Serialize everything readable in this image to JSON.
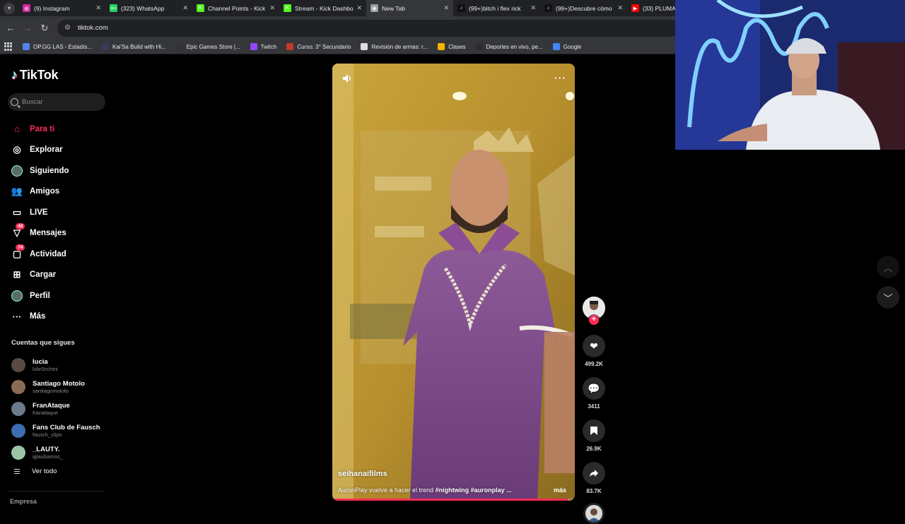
{
  "browser": {
    "tabs": [
      {
        "label": "(9) Instagram",
        "color": "#d6249f",
        "glyph": "◎"
      },
      {
        "label": "(323) WhatsApp",
        "color": "#25d366",
        "glyph": "99+"
      },
      {
        "label": "Channel Points - Kick",
        "color": "#53fc18",
        "glyph": "K"
      },
      {
        "label": "Stream - Kick Dashbo",
        "color": "#53fc18",
        "glyph": "K"
      },
      {
        "label": "New Tab",
        "color": "#9aa0a6",
        "glyph": "◉",
        "active": true
      },
      {
        "label": "(99+)bitch i flex rick",
        "color": "#111111",
        "glyph": "♪"
      },
      {
        "label": "(99+)Descubre cómo",
        "color": "#111111",
        "glyph": "♪"
      },
      {
        "label": "(33) PLUMA",
        "color": "#ff0000",
        "glyph": "▶"
      }
    ],
    "url": "tiktok.com",
    "bookmarks": [
      {
        "label": "OP.GG LAS - Estadís...",
        "color": "#5383e8"
      },
      {
        "label": "Kai'Sa Build with Hi...",
        "color": "#3a3a5a"
      },
      {
        "label": "Epic Games Store |...",
        "color": "#333333"
      },
      {
        "label": "Twitch",
        "color": "#9146ff"
      },
      {
        "label": "Curso: 3° Secundario",
        "color": "#c0392b"
      },
      {
        "label": "Revisión de armas: r...",
        "color": "#dddddd"
      },
      {
        "label": "Clases",
        "color": "#f4b400"
      },
      {
        "label": "Deportes en vivo, pe...",
        "color": "#2c2c2c"
      },
      {
        "label": "Google",
        "color": "#4285f4"
      }
    ]
  },
  "tiktok": {
    "brand": "TikTok",
    "search_placeholder": "Buscar",
    "nav": [
      {
        "label": "Para ti",
        "icon": "home-icon",
        "glyph": "⌂",
        "active": true
      },
      {
        "label": "Explorar",
        "icon": "compass-icon",
        "glyph": "◎"
      },
      {
        "label": "Siguiendo",
        "icon": "following-avatar-icon",
        "glyph": "●"
      },
      {
        "label": "Amigos",
        "icon": "friends-icon",
        "glyph": "👥"
      },
      {
        "label": "LIVE",
        "icon": "live-icon",
        "glyph": "▭"
      },
      {
        "label": "Mensajes",
        "icon": "messages-icon",
        "glyph": "▽",
        "badge": "48"
      },
      {
        "label": "Actividad",
        "icon": "activity-icon",
        "glyph": "▢",
        "badge": "74"
      },
      {
        "label": "Cargar",
        "icon": "upload-icon",
        "glyph": "⊞"
      },
      {
        "label": "Perfil",
        "icon": "profile-avatar-icon",
        "glyph": "●"
      },
      {
        "label": "Más",
        "icon": "more-icon",
        "glyph": "···"
      }
    ],
    "following_title": "Cuentas que sigues",
    "following": [
      {
        "name": "lucia",
        "user": "lubr0cchini",
        "color": "#5a4a44"
      },
      {
        "name": "Santiago Motolo",
        "user": "santiagomotolo",
        "color": "#8a6b55"
      },
      {
        "name": "FranAtaque",
        "user": "franataque",
        "color": "#6b7b8c"
      },
      {
        "name": "Fans Club de Fausch",
        "user": "fausch_clips",
        "color": "#3d6db3"
      },
      {
        "name": "_LAUTY.",
        "user": "iglaubarrios_",
        "color": "#9bc4a6"
      }
    ],
    "see_all": "Ver todo",
    "company": "Empresa"
  },
  "video": {
    "author": "seihanaifilms",
    "caption_text": "AuronPlay vuelve a hacer el trend ",
    "caption_tags": "#nightwing #auronplay ...",
    "more_label": "más",
    "progress": 0.97
  },
  "actions": {
    "likes": "499.2K",
    "comments": "3411",
    "saves": "26.9K",
    "shares": "83.7K"
  }
}
